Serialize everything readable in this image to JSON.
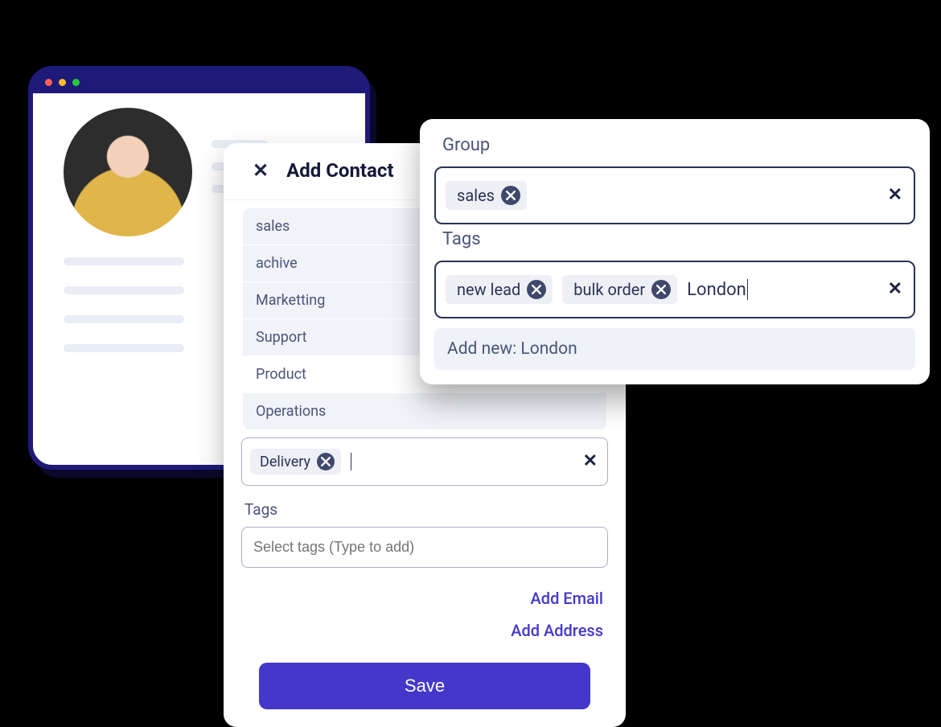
{
  "modal": {
    "title": "Add Contact",
    "suggestions": [
      "sales",
      "achive",
      "Marketting",
      "Support",
      "Product",
      "Operations"
    ],
    "suggestion_plain_index": 4,
    "selected_group_chip": "Delivery",
    "tags_label": "Tags",
    "tags_placeholder": "Select tags (Type to add)",
    "add_email": "Add Email",
    "add_address": "Add Address",
    "save": "Save"
  },
  "popover": {
    "group_label": "Group",
    "group_chip": "sales",
    "tags_label": "Tags",
    "tag_chips": [
      "new lead",
      "bulk order"
    ],
    "typed": "London",
    "add_new_prefix": "Add new: ",
    "add_new_value": "London"
  }
}
